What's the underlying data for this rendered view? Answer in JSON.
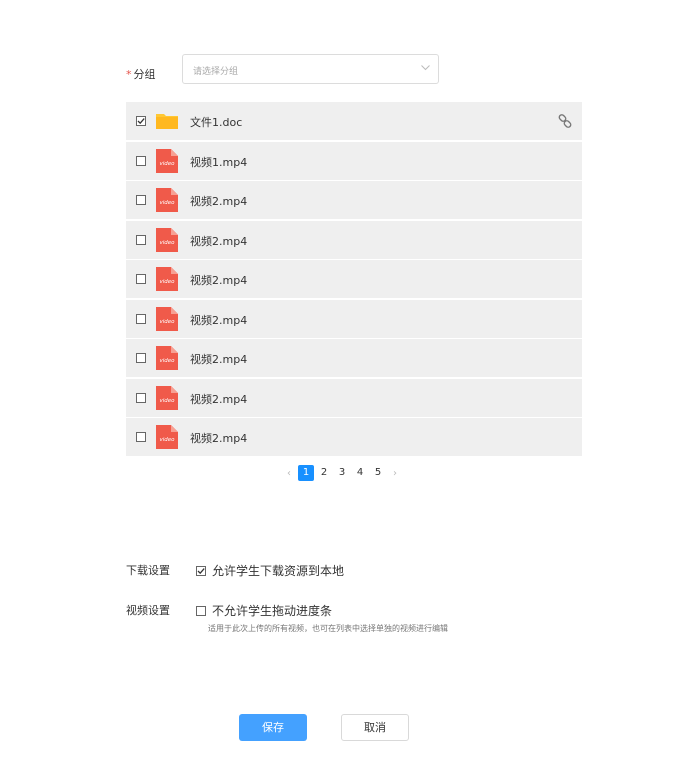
{
  "group": {
    "required_mark": "*",
    "label": "分组",
    "placeholder": "请选择分组"
  },
  "files": [
    {
      "name": "文件1.doc",
      "type": "folder",
      "checked": true,
      "link_icon": "link-icon"
    },
    {
      "name": "视频1.mp4",
      "type": "video",
      "checked": false
    },
    {
      "name": "视频2.mp4",
      "type": "video",
      "checked": false
    },
    {
      "name": "视频2.mp4",
      "type": "video",
      "checked": false
    },
    {
      "name": "视频2.mp4",
      "type": "video",
      "checked": false
    },
    {
      "name": "视频2.mp4",
      "type": "video",
      "checked": false
    },
    {
      "name": "视频2.mp4",
      "type": "video",
      "checked": false
    },
    {
      "name": "视频2.mp4",
      "type": "video",
      "checked": false
    },
    {
      "name": "视频2.mp4",
      "type": "video",
      "checked": false
    }
  ],
  "video_icon_text": "video",
  "pagination": {
    "prev": "‹",
    "next": "›",
    "pages": [
      "1",
      "2",
      "3",
      "4",
      "5"
    ],
    "current": "1"
  },
  "settings": {
    "download": {
      "label": "下载设置",
      "option": "允许学生下载资源到本地",
      "checked": true
    },
    "video": {
      "label": "视频设置",
      "option": "不允许学生拖动进度条",
      "checked": false,
      "hint": "适用于此次上传的所有视频，也可在列表中选择单独的视频进行编辑"
    }
  },
  "buttons": {
    "save": "保存",
    "cancel": "取消"
  },
  "colors": {
    "primary": "#1890ff",
    "save_button": "#44a1ff",
    "row_bg": "#efefef",
    "video_icon": "#f05a4a",
    "folder_icon": "#ffc833",
    "required": "#e5534b"
  }
}
